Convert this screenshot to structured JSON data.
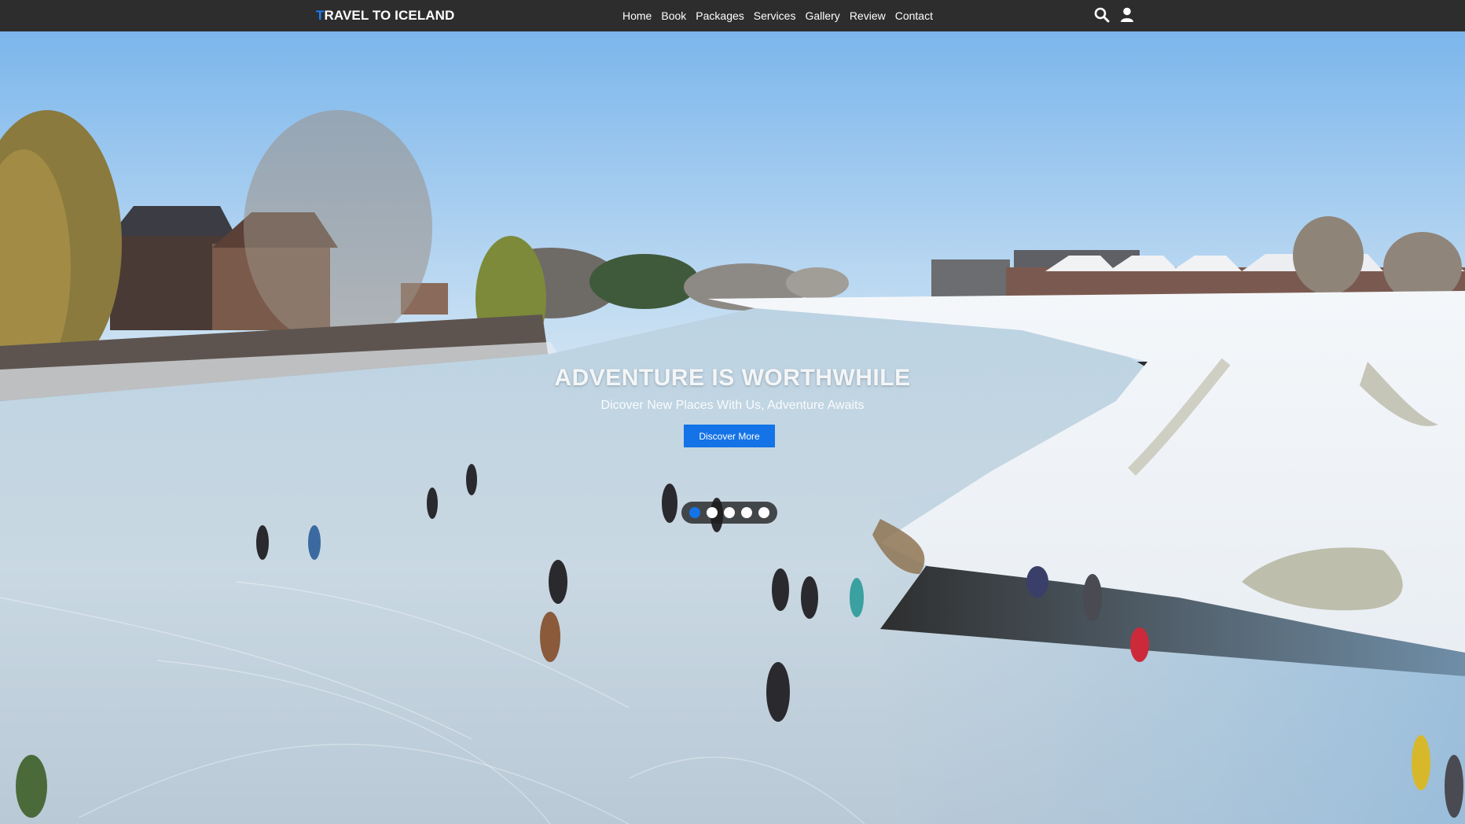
{
  "navbar": {
    "brand_first_letter": "T",
    "brand_rest": "RAVEL TO ICELAND",
    "links": [
      "Home",
      "Book",
      "Packages",
      "Services",
      "Gallery",
      "Review",
      "Contact"
    ],
    "icons": [
      "search-icon",
      "user-icon"
    ]
  },
  "hero": {
    "title": "ADVENTURE IS WORTHWHILE",
    "subtitle": "Dicover New Places With Us, Adventure Awaits",
    "cta_label": "Discover More",
    "slides_count": 5,
    "active_slide": 1
  },
  "colors": {
    "navbar_bg": "#2d2d2d",
    "brand_accent": "#1e7cff",
    "cta_bg": "#1473e6",
    "sky": "#8ec1ee",
    "ice": "#c6d8e6",
    "snow": "#f2f5f8"
  }
}
